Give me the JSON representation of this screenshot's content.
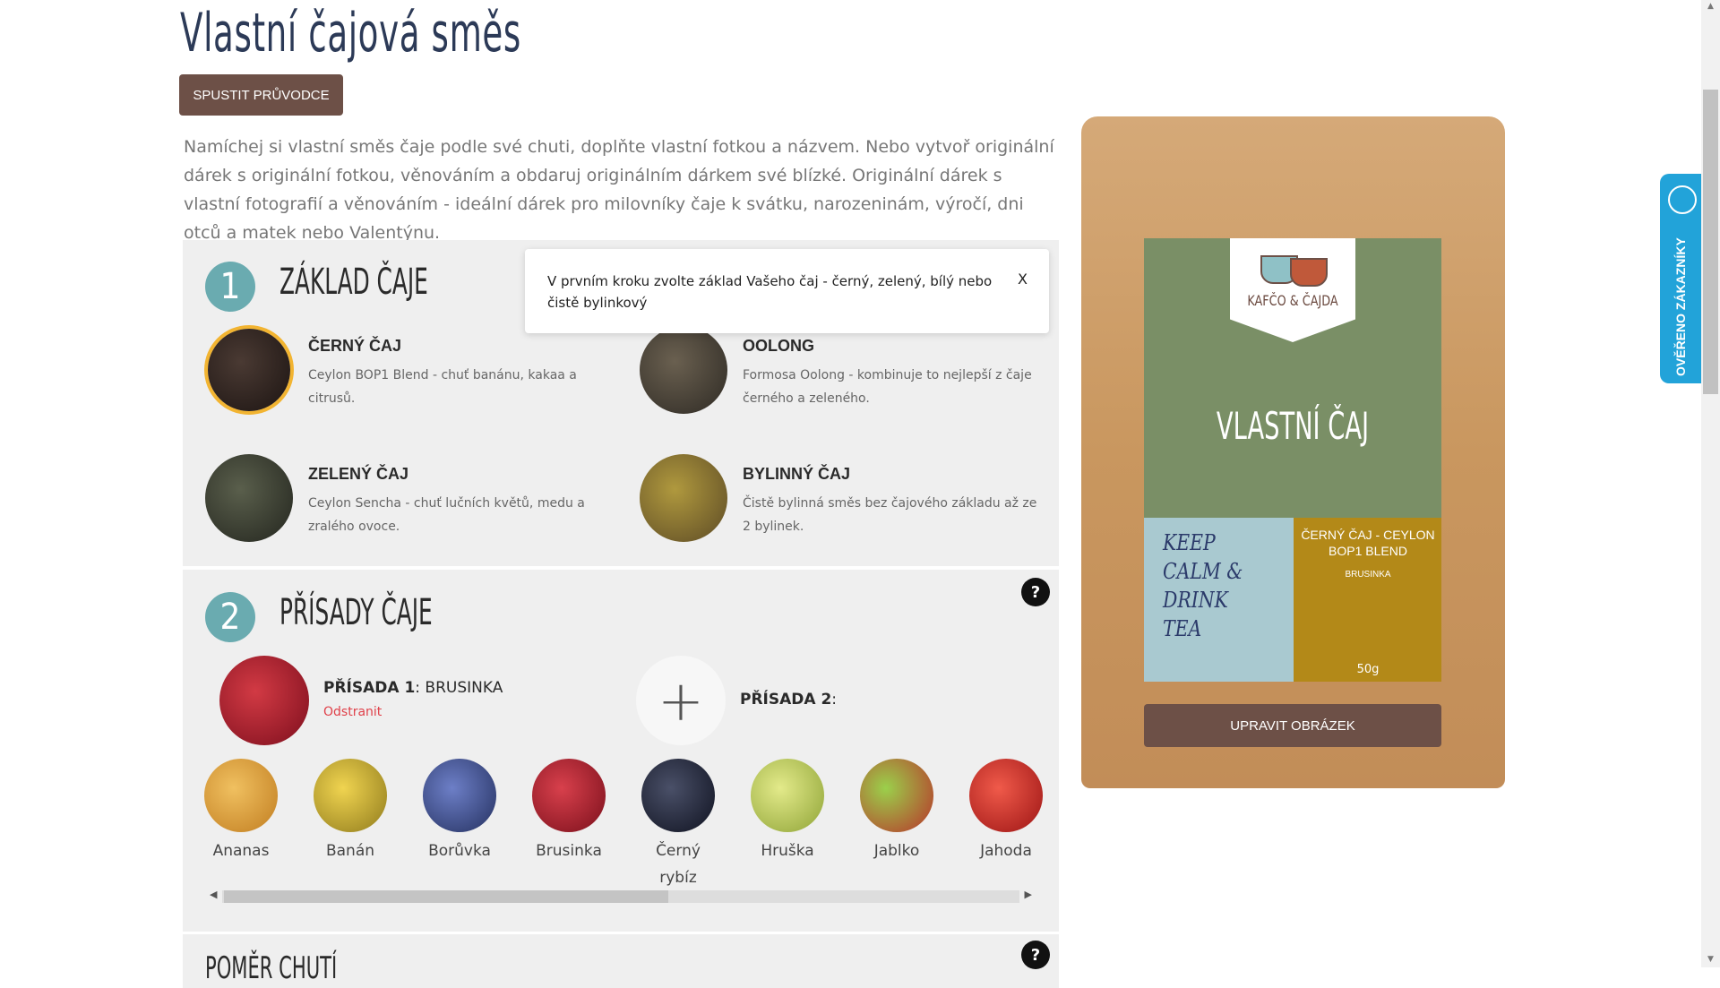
{
  "page": {
    "title": "Vlastní čajová směs"
  },
  "wizard_button": {
    "label": "SPUSTIT PRŮVODCE"
  },
  "intro": "Namíchej si vlastní směs čaje podle své chuti, doplňte vlastní fotkou a názvem. Nebo vytvoř originální dárek s originální fotkou, věnováním a obdaruj originálním dárkem své blízké. Originální dárek s vlastní fotografií a věnováním - ideální dárek pro milovníky čaje k svátku, narozeninám, výročí, dni otců a matek nebo Valentýnu.",
  "step1": {
    "number": "1",
    "title": "ZÁKLAD ČAJE",
    "options": [
      {
        "name": "ČERNÝ ČAJ",
        "desc": "Ceylon BOP1 Blend - chuť banánu, kakaa a citrusů.",
        "selected": true,
        "color": "#2a1f1b"
      },
      {
        "name": "OOLONG",
        "desc": "Formosa Oolong - kombinuje to nejlepší z čaje černého a zeleného.",
        "selected": false,
        "color": "#4a4339"
      },
      {
        "name": "ZELENÝ ČAJ",
        "desc": "Ceylon Sencha - chuť lučních květů, medu a zralého ovoce.",
        "selected": false,
        "color": "#3b3f33"
      },
      {
        "name": "BYLINNÝ ČAJ",
        "desc": "Čistě bylinná směs bez čajového základu až ze 2 bylinek.",
        "selected": false,
        "color": "#7a6a3c"
      }
    ]
  },
  "tooltip": {
    "text": "V prvním kroku zvolte základ Vašeho čaj - černý, zelený, bílý nebo čistě bylinkový",
    "close": "X"
  },
  "step2": {
    "number": "2",
    "title": "PŘÍSADY ČAJE",
    "help": "?",
    "slot1": {
      "label_bold": "PŘÍSADA 1",
      "label_value": ": BRUSINKA",
      "remove": "Odstranit"
    },
    "slot2": {
      "label_bold": "PŘÍSADA 2",
      "label_value": ":"
    },
    "add_symbol": "+",
    "ingredients": [
      {
        "name": "Ananas",
        "color": "#e3a43a"
      },
      {
        "name": "Banán",
        "color": "#d8b32e"
      },
      {
        "name": "Borůvka",
        "color": "#3b4d8f"
      },
      {
        "name": "Brusinka",
        "color": "#b3172b"
      },
      {
        "name": "Černý rybíz",
        "color": "#1e2233"
      },
      {
        "name": "Hruška",
        "color": "#b7c448"
      },
      {
        "name": "Jablko",
        "color": "#5f9e2c"
      },
      {
        "name": "Jahoda",
        "color": "#d42a2a"
      }
    ],
    "scroll_fraction": 0.54
  },
  "step3": {
    "title": "POMĚR CHUTÍ",
    "help": "?"
  },
  "preview": {
    "brand": "KAFČO & ČAJDA",
    "title": "VLASTNÍ ČAJ",
    "slogan": "KEEP CALM & DRINK TEA",
    "product_name": "ČERNÝ ČAJ - CEYLON BOP1 BLEND",
    "product_sub": "BRUSINKA",
    "weight": "50g",
    "edit_button": "UPRAVIT OBRÁZEK"
  },
  "verified": {
    "label": "OVĚŘENO ZÁKAZNÍKY"
  },
  "colors": {
    "brown": "#6d5047",
    "teal": "#6aabb0",
    "green_label": "#7a8f66",
    "gold_label": "#b38918",
    "verified_blue": "#22a3d9"
  }
}
